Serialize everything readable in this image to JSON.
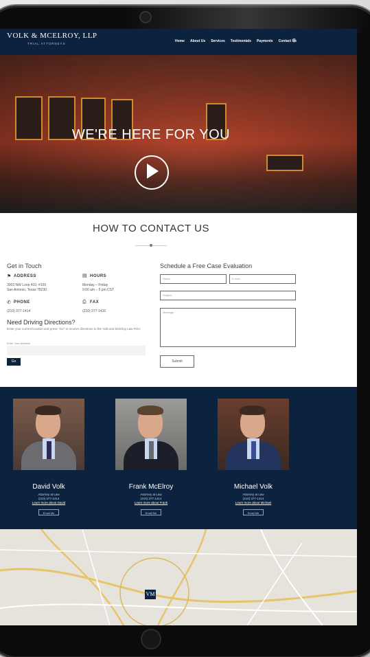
{
  "site": {
    "logo": "VOLK & MCELROY, LLP",
    "logo_sub": "TRIAL ATTORNEYS",
    "menu": [
      "Home",
      "About Us",
      "Services",
      "Testimonials",
      "Payments",
      "Contact Us"
    ],
    "search_icon": "search-icon"
  },
  "hero": {
    "title": "WE'RE HERE FOR YOU",
    "play_icon": "play-icon",
    "scroll_icon": "chevron-down-icon"
  },
  "contact": {
    "title": "HOW TO CONTACT US",
    "get_in_touch": "Get in Touch",
    "address_label": "ADDRESS",
    "address_line1": "3003 NW Loop 410, #100",
    "address_line2": "San Antonio, Texas 78230",
    "hours_label": "HOURS",
    "hours_line1": "Monday – Friday",
    "hours_line2": "9:00 am – 5 pm CST",
    "phone_label": "PHONE",
    "phone_value": "(210) 377-1414",
    "fax_label": "FAX",
    "fax_value": "(210) 377-1415",
    "directions_title": "Need Driving Directions?",
    "directions_text": "Enter your current location and press \"Go\" to receive directions to the Volk and McElroy Law Firm.",
    "address_input_label": "Enter Your Address",
    "go_label": "Go"
  },
  "form": {
    "title": "Schedule a Free Case Evaluation",
    "name_placeholder": "Name",
    "email_placeholder": "E-mail",
    "subject_placeholder": "Subject",
    "message_placeholder": "Message",
    "submit_label": "Submit"
  },
  "team": [
    {
      "name": "David Volk",
      "title": "Attorney at Law",
      "phone": "(210) 377-1414",
      "link": "Learn more about David",
      "email_label": "Email Me"
    },
    {
      "name": "Frank McElroy",
      "title": "Attorney at Law",
      "phone": "(210) 377-1414",
      "link": "Learn more about Frank",
      "email_label": "Email Me"
    },
    {
      "name": "Michael Volk",
      "title": "Attorney at Law",
      "phone": "(210) 377-1414",
      "link": "Learn more about Michael",
      "email_label": "Email Me"
    }
  ],
  "map": {
    "marker_label": "VM"
  },
  "colors": {
    "navy": "#0c2340",
    "hero_red": "#b8452d"
  }
}
